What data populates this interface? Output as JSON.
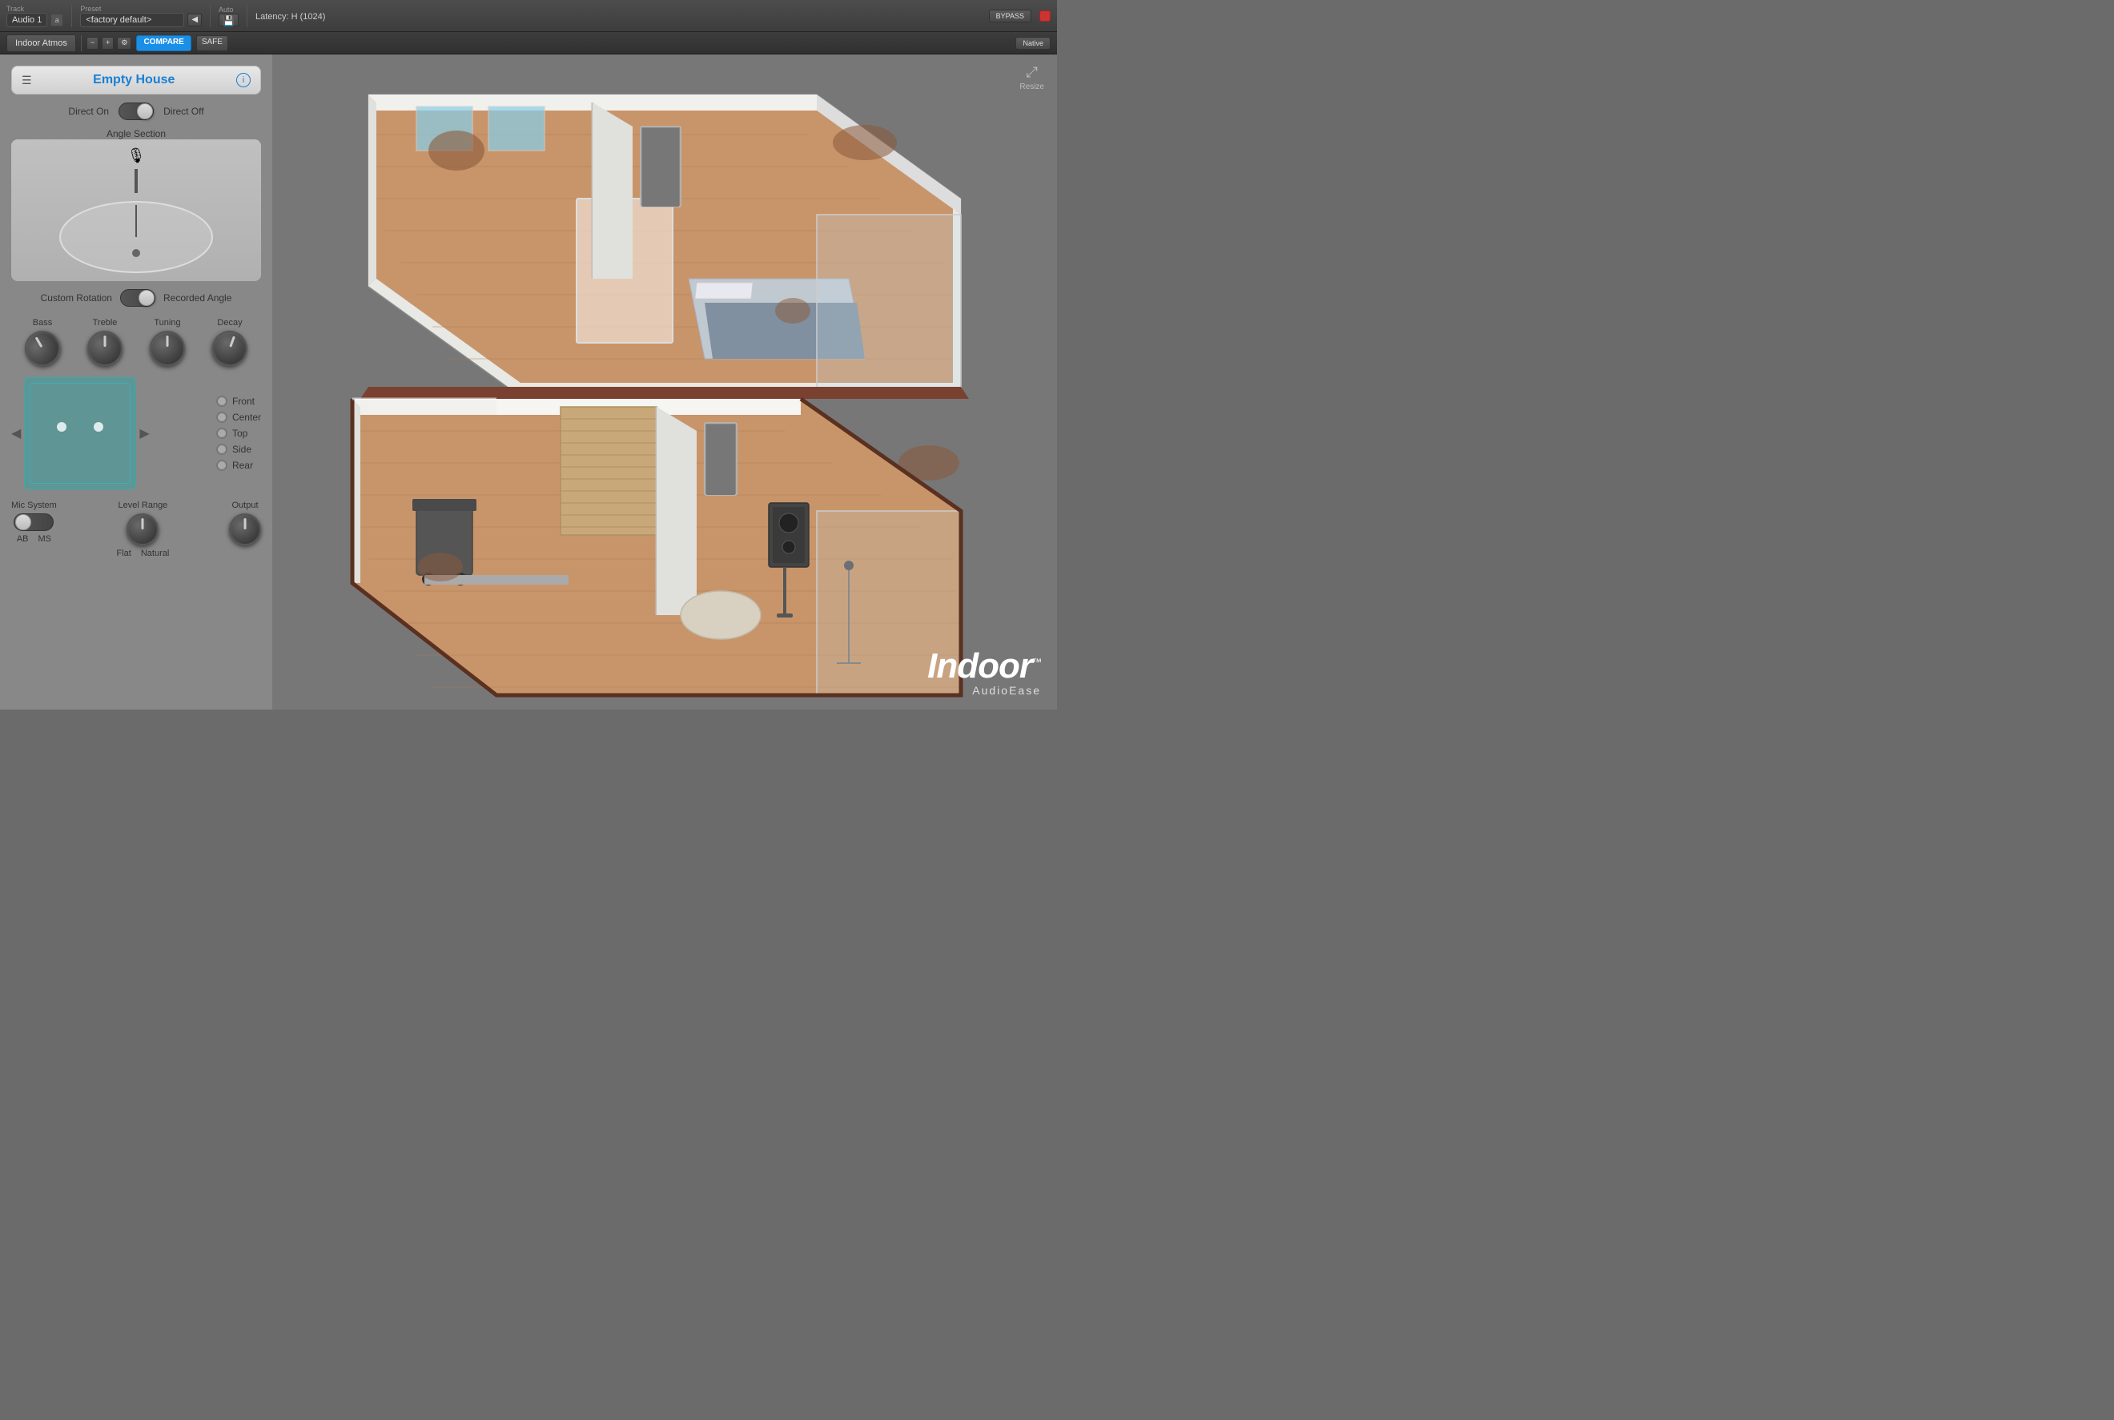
{
  "titlebar": {
    "track_label": "Track",
    "track_name": "Audio 1",
    "track_id": "a",
    "preset_label": "Preset",
    "preset_name": "<factory default>",
    "auto_label": "Auto",
    "latency_label": "Latency: H (1024)",
    "bypass_label": "BYPASS",
    "save_label": "💾",
    "minus_label": "−",
    "plus_label": "+",
    "settings_label": "⚙"
  },
  "toolbar": {
    "plugin_name": "Indoor Atmos",
    "compare_label": "COMPARE",
    "safe_label": "SAFE",
    "native_label": "Native"
  },
  "panel": {
    "title": "Empty House",
    "direct_on": "Direct On",
    "direct_off": "Direct Off",
    "angle_section": "Angle Section",
    "custom_rotation": "Custom Rotation",
    "recorded_angle": "Recorded Angle",
    "bass_label": "Bass",
    "treble_label": "Treble",
    "tuning_label": "Tuning",
    "decay_label": "Decay",
    "speaker_options": [
      "Front",
      "Center",
      "Top",
      "Side",
      "Rear"
    ],
    "mic_system_label": "Mic System",
    "level_range_label": "Level Range",
    "output_label": "Output",
    "ab_label": "AB",
    "ms_label": "MS",
    "flat_label": "Flat",
    "natural_label": "Natural"
  },
  "scene": {
    "background_color": "#777777"
  },
  "logo": {
    "indoor_text": "Indoor",
    "tm_text": "™",
    "audioease_text": "AudioEase"
  },
  "resize": {
    "label": "Resize"
  }
}
